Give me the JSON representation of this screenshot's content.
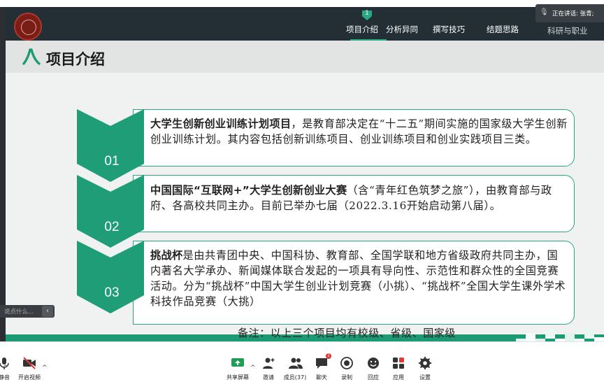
{
  "nav": {
    "active_marker": "1",
    "items": [
      "项目介绍",
      "分析异同",
      "撰写技巧",
      "结题思路",
      "科研与职业"
    ]
  },
  "speaker": {
    "label": "正在讲话:",
    "name": "张青;"
  },
  "slide": {
    "title": "项目介绍",
    "items": [
      {
        "number": "01",
        "bold": "大学生创新创业训练计划项目",
        "text": "，是教育部决定在“十二五”期间实施的国家级大学生创新创业训练计划。其内容包括创新训练项目、创业训练项目和创业实践项目三类。"
      },
      {
        "number": "02",
        "bold": "中国国际“互联网+”大学生创新创业大赛",
        "text": "（含“青年红色筑梦之旅”），由教育部与政府、各高校共同主办。目前已举办七届（2022.3.16开始启动第八届）。"
      },
      {
        "number": "03",
        "bold": "挑战杯",
        "text": "是由共青团中央、中国科协、教育部、全国学联和地方省级政府共同主办，国内著名大学承办、新闻媒体联合发起的一项具有导向性、示范性和群众性的全国竞赛活动。分为“挑战杯”中国大学生创业计划竞赛（小挑）、“挑战杯”全国大学生课外学术科技作品竞赛（大挑）"
      }
    ],
    "note": "备注：以上三个项目均有校级、省级、国家级"
  },
  "chat": {
    "placeholder": "说点什么...",
    "collapse_icon": "chevron-left-icon"
  },
  "toolbar": {
    "left": [
      {
        "label": "静音",
        "icon": "mic-icon"
      },
      {
        "label": "开启视频",
        "icon": "video-off-icon"
      }
    ],
    "center": [
      {
        "label": "共享屏幕",
        "icon": "share-screen-icon"
      },
      {
        "label": "邀请",
        "icon": "invite-icon"
      },
      {
        "label": "成员(37)",
        "icon": "members-icon"
      },
      {
        "label": "聊天",
        "icon": "chat-icon",
        "badge": "1"
      },
      {
        "label": "录制",
        "icon": "record-icon"
      },
      {
        "label": "回应",
        "icon": "reaction-icon"
      },
      {
        "label": "应用",
        "icon": "apps-icon"
      },
      {
        "label": "设置",
        "icon": "settings-icon"
      }
    ]
  },
  "colors": {
    "accent": "#1c9a73",
    "header": "#232f35",
    "badge": "#e53935"
  }
}
